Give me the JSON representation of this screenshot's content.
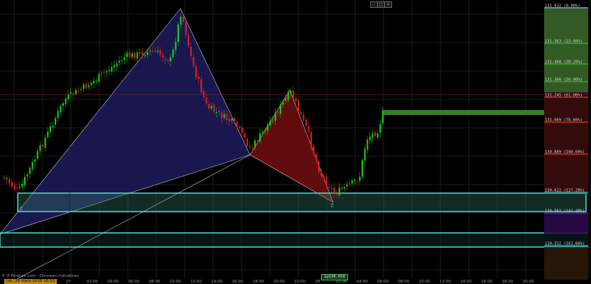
{
  "window_controls": [
    "–",
    "□",
    "×"
  ],
  "watermark": "© IT-Finance.com - Données indicatives",
  "date_badge": "lun. 26 mars 2018 18:10",
  "price_badge": "1@130.658",
  "time_axis": {
    "labels": [
      "18:00",
      "20:00",
      "22:00",
      "27",
      "02:00",
      "04:00",
      "06:00",
      "08:00",
      "10:00",
      "12:00",
      "14:00",
      "16:00",
      "18:00",
      "20:00",
      "22:00",
      "28",
      "02:00",
      "04:00",
      "06:00",
      "08:00",
      "10:00",
      "12:00",
      "14:00",
      "16:00",
      "18:00",
      "20:00"
    ]
  },
  "fib_levels": [
    {
      "label": "131.632 (0.00%)",
      "color": "#8c9ad8"
    },
    {
      "label": "131.563 (23.60%)",
      "color": "#27c227"
    },
    {
      "label": "131.468 (38.20%)",
      "color": "#27c227"
    },
    {
      "label": "131.366 (50.00%)",
      "color": "#27c227"
    },
    {
      "label": "131.245 (61.80%)",
      "color": "#e03030"
    },
    {
      "label": "131.089 (78.60%)",
      "color": "#e03030"
    },
    {
      "label": "130.889 (100.00%)",
      "color": "#e03030"
    },
    {
      "label": "130.622 (127.20%)",
      "color": "#28d2c8"
    },
    {
      "label": "130.562 (141.40%)",
      "color": "#6a3ad8"
    },
    {
      "label": "130.312 (161.80%)",
      "color": "#28d2c8"
    }
  ],
  "colors": {
    "background": "#000000",
    "bull_candle": "#18c818",
    "bear_candle": "#d62020",
    "pattern_xab": "#1c1a55",
    "pattern_bcd": "#6b0d0d",
    "zone_cyan": "#4ae2d2",
    "target_green": "#3c7a2c"
  }
}
